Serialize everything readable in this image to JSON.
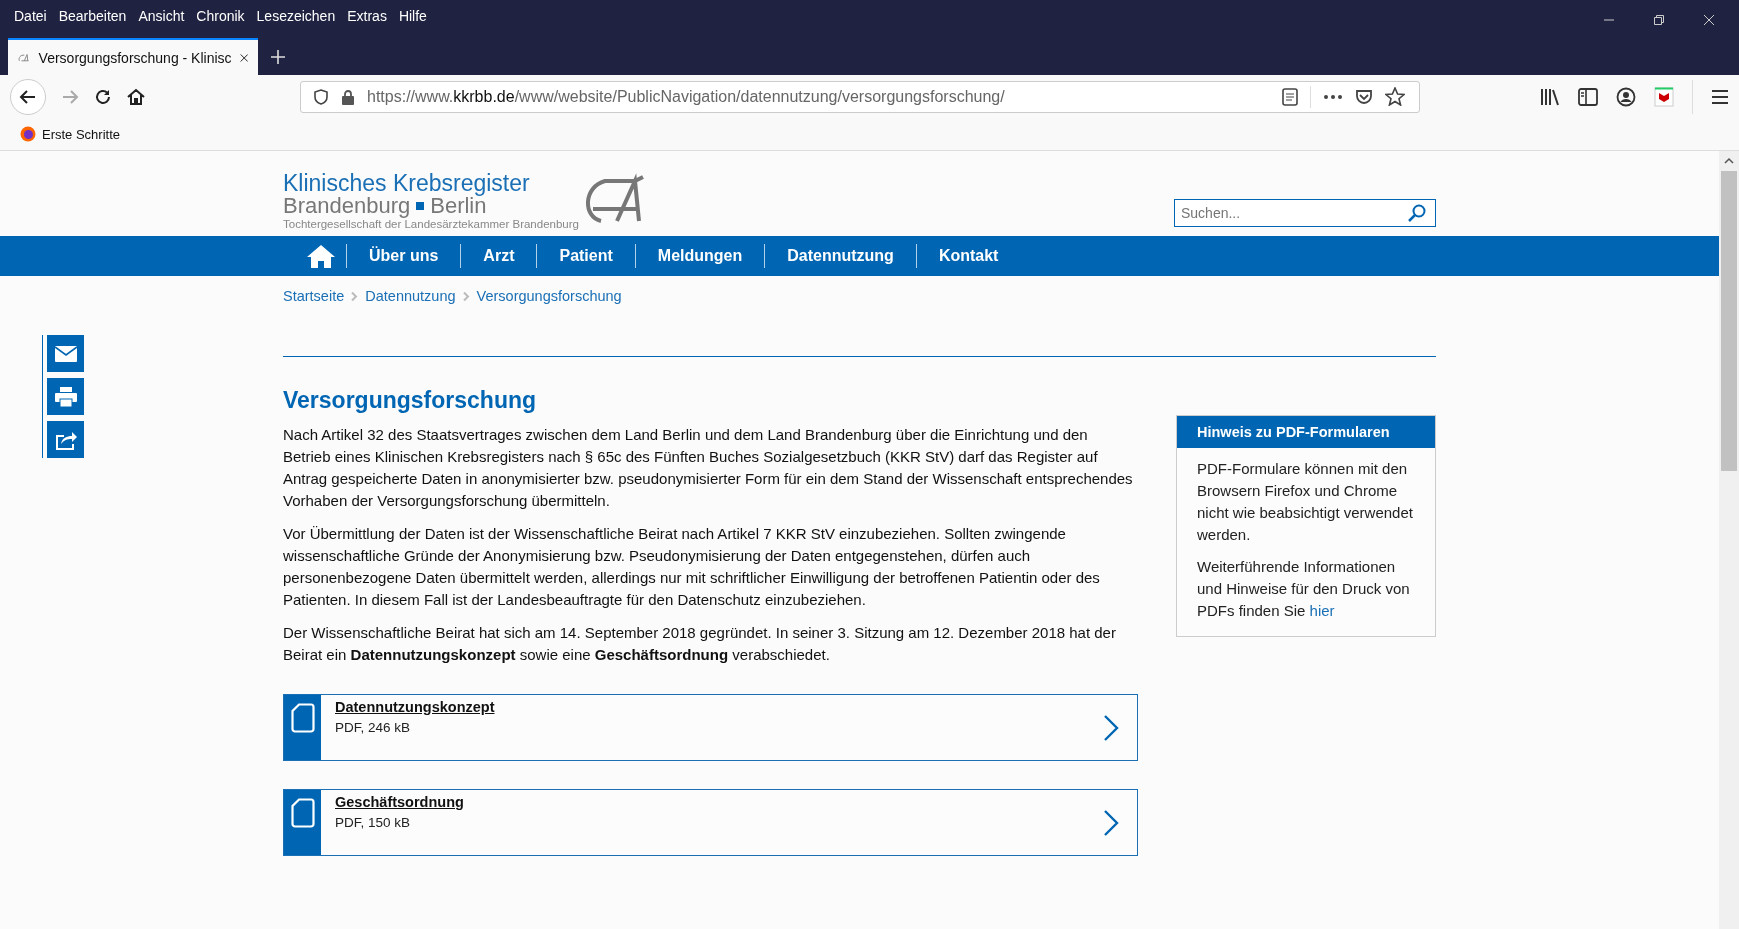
{
  "menu_bar": [
    "Datei",
    "Bearbeiten",
    "Ansicht",
    "Chronik",
    "Lesezeichen",
    "Extras",
    "Hilfe"
  ],
  "tabs": [
    {
      "title": "Versorgungsforschung - Klinisc",
      "selected": true
    }
  ],
  "address_bar": {
    "prefix": "https://www.",
    "domain": "kkrbb.de",
    "path": "/www/website/PublicNavigation/datennutzung/versorgungsforschung/"
  },
  "bookmarks": [
    "Erste Schritte"
  ],
  "site": {
    "logo": {
      "line_1": "Klinisches Krebsregister",
      "line_2a": "Brandenburg",
      "line_2b": "Berlin",
      "line_3": "Tochtergesellschaft der Landesärztekammer Brandenburg"
    },
    "search": {
      "placeholder": "Suchen..."
    },
    "nav": [
      {
        "label": "Über uns"
      },
      {
        "label": "Arzt"
      },
      {
        "label": "Patient"
      },
      {
        "label": "Meldungen"
      },
      {
        "label": "Datennutzung"
      },
      {
        "label": "Kontakt"
      }
    ],
    "breadcrumb": [
      "Startseite",
      "Datennutzung",
      "Versorgungsforschung"
    ],
    "heading": "Versorgungsforschung",
    "paragraphs": [
      "Nach Artikel 32 des Staatsvertrages zwischen dem Land Berlin und dem Land Brandenburg über die Einrichtung und den Betrieb eines Klinischen Krebsregisters nach § 65c des Fünften Buches Sozialgesetzbuch (KKR StV) darf das Register auf Antrag gespeicherte Daten in anonymisierter bzw. pseudonymisierter Form für ein dem Stand der Wissenschaft entsprechendes Vorhaben der Versorgungsforschung übermitteln.",
      "Vor Übermittlung der Daten ist der Wissenschaftliche Beirat nach Artikel 7 KKR StV einzubeziehen. Sollten zwingende wissenschaftliche Gründe der Anonymisierung bzw. Pseudonymisierung der Daten entgegenstehen, dürfen auch personenbezogene Daten übermittelt werden, allerdings nur mit schriftlicher Einwilligung der betroffenen Patientin oder des Patienten. In diesem Fall ist der Landesbeauftragte für den Datenschutz einzubeziehen.",
      "Der Wissenschaftliche Beirat hat sich am 14. September 2018 gegründet. In seiner 3. Sitzung am 12. Dezember 2018 hat der Beirat ein **Datennutzungskonzept** sowie eine **Geschäftsordnung** verabschiedet."
    ],
    "documents": [
      {
        "title": "Datennutzungskonzept",
        "meta": "PDF, 246 kB"
      },
      {
        "title": "Geschäftsordnung",
        "meta": "PDF, 150 kB"
      }
    ],
    "info_box": {
      "title": "Hinweis zu PDF-Formularen",
      "text_1": "PDF-Formulare können mit den Browsern Firefox und Chrome nicht wie beabsichtigt verwendet werden.",
      "text_2": "Weiterführende Informationen und Hinweise für den Druck von PDFs finden Sie",
      "link": "hier"
    }
  }
}
